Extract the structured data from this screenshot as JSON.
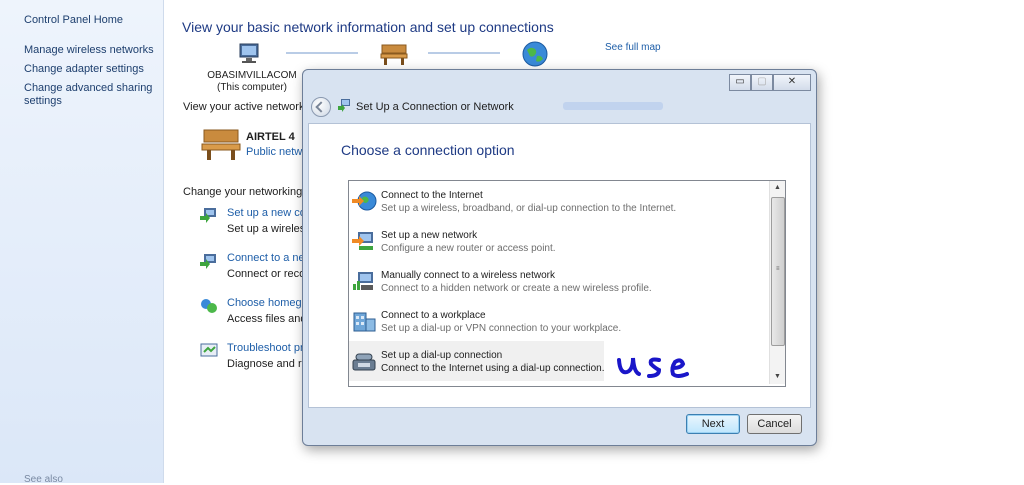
{
  "left_pane": {
    "home": "Control Panel Home",
    "links": [
      "Manage wireless networks",
      "Change adapter settings",
      "Change advanced sharing settings"
    ],
    "see_also": "See also"
  },
  "network_center": {
    "title": "View your basic network information and set up connections",
    "see_full_map": "See full map",
    "computer_name": "OBASIMVILLACOM",
    "computer_sub": "(This computer)",
    "active_title": "View your active networks",
    "network_name": "AIRTEL  4",
    "network_type": "Public netwo",
    "change_title": "Change your networking se",
    "tasks": [
      {
        "link": "Set up a new con",
        "desc": "Set up a wireless,"
      },
      {
        "link": "Connect to a netw",
        "desc": "Connect or recon"
      },
      {
        "link": "Choose homegro",
        "desc": "Access files and p"
      },
      {
        "link": "Troubleshoot pro",
        "desc": "Diagnose and rep"
      }
    ]
  },
  "dialog": {
    "title": "Set Up a Connection or Network",
    "heading": "Choose a connection option",
    "minimize": "▭",
    "maximize": "▢",
    "close": "✕",
    "options": [
      {
        "title": "Connect to the Internet",
        "desc": "Set up a wireless, broadband, or dial-up connection to the Internet.",
        "icon": "globe-icon"
      },
      {
        "title": "Set up a new network",
        "desc": "Configure a new router or access point.",
        "icon": "router-icon"
      },
      {
        "title": "Manually connect to a wireless network",
        "desc": "Connect to a hidden network or create a new wireless profile.",
        "icon": "wireless-icon"
      },
      {
        "title": "Connect to a workplace",
        "desc": "Set up a dial-up or VPN connection to your workplace.",
        "icon": "workplace-icon"
      },
      {
        "title": "Set up a dial-up connection",
        "desc": "Connect to the Internet using a dial-up connection.",
        "icon": "phone-icon"
      }
    ],
    "next_label": "Next",
    "cancel_label": "Cancel"
  },
  "annotation": "use",
  "colors": {
    "link": "#1e5ea8",
    "heading": "#1e3a84",
    "scrawl": "#1a16c9"
  }
}
